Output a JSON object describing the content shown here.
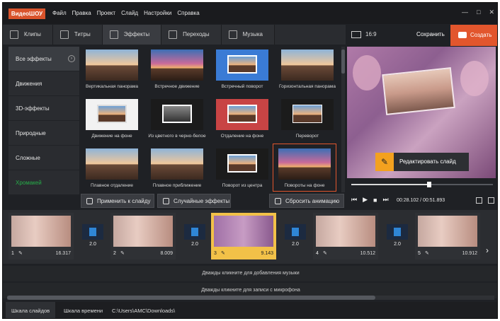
{
  "app": {
    "logo": "ВидеоШОУ",
    "menu": [
      "Файл",
      "Правка",
      "Проект",
      "Слайд",
      "Настройки",
      "Справка"
    ],
    "window_buttons": [
      "—",
      "□",
      "✕"
    ]
  },
  "tabs": [
    {
      "label": "Клипы",
      "icon": "film-icon"
    },
    {
      "label": "Титры",
      "icon": "text-icon"
    },
    {
      "label": "Эффекты",
      "icon": "magic-wand-icon"
    },
    {
      "label": "Переходы",
      "icon": "transitions-icon"
    },
    {
      "label": "Музыка",
      "icon": "music-icon"
    }
  ],
  "topright": {
    "ratio": "16:9",
    "save": "Сохранить",
    "create": "Создать"
  },
  "categories": [
    {
      "label": "Все эффекты"
    },
    {
      "label": "Движения"
    },
    {
      "label": "3D-эффекты"
    },
    {
      "label": "Природные"
    },
    {
      "label": "Сложные"
    },
    {
      "label": "Хромакей"
    }
  ],
  "effects": [
    {
      "label": "Вертикальная панорама"
    },
    {
      "label": "Встречное движение"
    },
    {
      "label": "Встречный поворот"
    },
    {
      "label": "Горизонтальная панорама"
    },
    {
      "label": "Движение на фоне"
    },
    {
      "label": "Из цветного в черно-белое"
    },
    {
      "label": "Отдаление на фоне"
    },
    {
      "label": "Переворот"
    },
    {
      "label": "Плавное отдаление"
    },
    {
      "label": "Плавное приближение"
    },
    {
      "label": "Поворот из центра"
    },
    {
      "label": "Повороты на фоне"
    }
  ],
  "actions": {
    "apply": "Применить к слайду",
    "random": "Случайные эффекты",
    "reset": "Сбросить анимацию"
  },
  "preview": {
    "edit": "Редактировать слайд",
    "position": 0.55,
    "time_current": "00:28.102",
    "time_total": "00:51.893"
  },
  "timeline": {
    "clips": [
      {
        "num": "1",
        "dur": "16.317"
      },
      {
        "num": "2",
        "dur": "8.009"
      },
      {
        "num": "3",
        "dur": "9.143"
      },
      {
        "num": "4",
        "dur": "10.512"
      },
      {
        "num": "5",
        "dur": "10.912"
      }
    ],
    "transitions": [
      "2.0",
      "2.0",
      "2.0",
      "2.0"
    ],
    "music_hint": "Дважды кликните для добавления музыки",
    "mic_hint": "Дважды кликните для записи с микрофона"
  },
  "status": {
    "tab1": "Шкала слайдов",
    "tab2": "Шкала времени",
    "path": "C:\\Users\\AMC\\Downloads\\"
  }
}
